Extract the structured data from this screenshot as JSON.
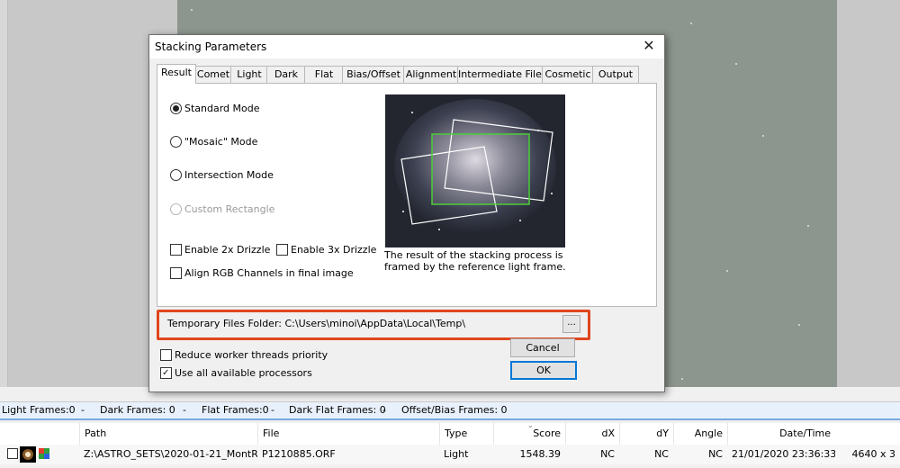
{
  "dialog": {
    "title": "Stacking Parameters",
    "close_icon": "✕",
    "tabs": [
      "Result",
      "Comet",
      "Light",
      "Dark",
      "Flat",
      "Bias/Offset",
      "Alignment",
      "Intermediate Files",
      "Cosmetic",
      "Output"
    ],
    "active_tab": "Result",
    "modes": [
      {
        "label": "Standard Mode",
        "checked": true,
        "disabled": false
      },
      {
        "label": "\"Mosaic\" Mode",
        "checked": false,
        "disabled": false
      },
      {
        "label": "Intersection Mode",
        "checked": false,
        "disabled": false
      },
      {
        "label": "Custom Rectangle",
        "checked": false,
        "disabled": true
      }
    ],
    "options": {
      "drizzle2x": "Enable 2x Drizzle",
      "drizzle3x": "Enable 3x Drizzle",
      "align_rgb": "Align RGB Channels in final image"
    },
    "caption": "The result of the stacking process is framed by the reference light frame.",
    "temp_folder_label": "Temporary Files Folder:",
    "temp_folder_path": "C:\\Users\\minoi\\AppData\\Local\\Temp\\",
    "browse_label": "...",
    "reduce_threads": {
      "label": "Reduce worker threads priority",
      "checked": false
    },
    "use_all_processors": {
      "label": "Use all available processors",
      "checked": true
    },
    "cancel": "Cancel",
    "ok": "OK",
    "highlight_color": "#e0461e"
  },
  "status": {
    "light": "Light Frames:0",
    "sep": "-",
    "dark": "Dark Frames: 0",
    "flat": "Flat Frames:0",
    "darkflat": "Dark Flat Frames: 0",
    "offset": "Offset/Bias Frames: 0"
  },
  "table": {
    "headers": [
      "Path",
      "File",
      "Type",
      "Score",
      "dX",
      "dY",
      "Angle",
      "Date/Time"
    ],
    "row": {
      "path": "Z:\\ASTRO_SETS\\2020-01-21_MontR...",
      "file": "P1210885.ORF",
      "type": "Light",
      "score": "1548.39",
      "dx": "NC",
      "dy": "NC",
      "angle": "NC",
      "datetime": "21/01/2020 23:36:33",
      "size": "4640 x 3"
    }
  }
}
